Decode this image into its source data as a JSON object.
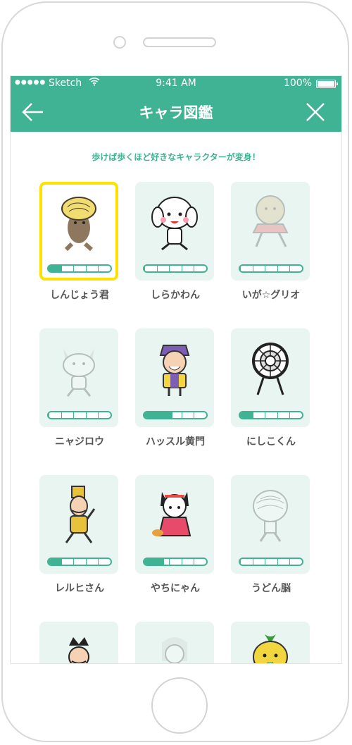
{
  "status": {
    "carrier": "Sketch",
    "time": "9:41 AM",
    "battery": "100%"
  },
  "header": {
    "title": "キャラ図鑑"
  },
  "subtitle": "歩けば歩くほど好きなキャラクターが変身！",
  "characters": [
    {
      "name": "しんじょう君",
      "progress": 0.2,
      "state": "selected",
      "icon": "shinjo-kun-character"
    },
    {
      "name": "しらかわん",
      "progress": 0,
      "state": "active",
      "icon": "shirakawan-character"
    },
    {
      "name": "いが☆グリオ",
      "progress": 0,
      "state": "faded",
      "icon": "iga-gurio-character"
    },
    {
      "name": "ニャジロウ",
      "progress": 0,
      "state": "faded",
      "icon": "nyajirou-character"
    },
    {
      "name": "ハッスル黄門",
      "progress": 0.45,
      "state": "active",
      "icon": "hustle-koumon-character"
    },
    {
      "name": "にしこくん",
      "progress": 0.2,
      "state": "active",
      "icon": "nishikokun-character"
    },
    {
      "name": "レルヒさん",
      "progress": 0.2,
      "state": "active",
      "icon": "lerch-san-character"
    },
    {
      "name": "やちにゃん",
      "progress": 0.32,
      "state": "active",
      "icon": "yachinyan-character"
    },
    {
      "name": "うどん脳",
      "progress": 0,
      "state": "faded",
      "icon": "udon-nou-character"
    }
  ],
  "partial_row_icons": [
    "king-character",
    "faded-girl-character",
    "yuzu-character"
  ]
}
